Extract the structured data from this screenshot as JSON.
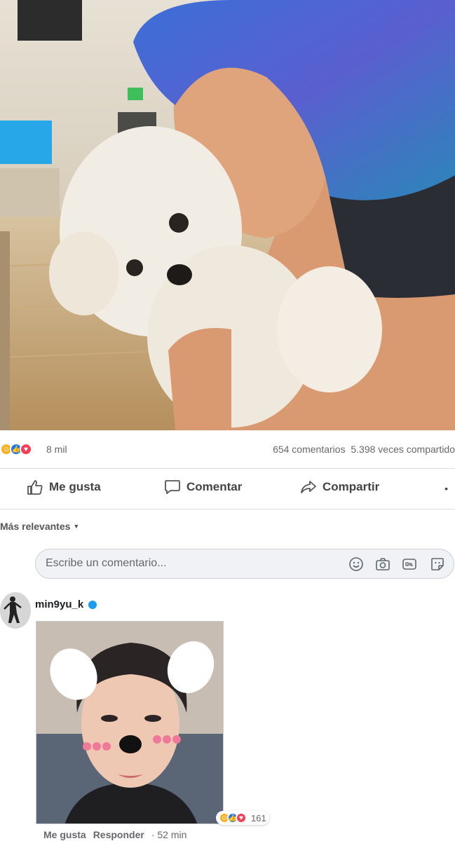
{
  "post": {
    "reaction_count": "8 mil",
    "comments_count": "654 comentarios",
    "shares_count": "5.398 veces compartido"
  },
  "actions": {
    "like": "Me gusta",
    "comment": "Comentar",
    "share": "Compartir",
    "more": "•"
  },
  "sort": {
    "label": "Más relevantes"
  },
  "comment_box": {
    "placeholder": "Escribe un comentario..."
  },
  "comment": {
    "username": "min9yu_k",
    "reaction_count": "161",
    "like_link": "Me gusta",
    "reply_link": "Responder",
    "time": "52 min"
  },
  "icons": {
    "like": "thumbs-up-icon",
    "comment": "speech-bubble-icon",
    "share": "share-arrow-icon",
    "emoji": "smiley-icon",
    "camera": "camera-icon",
    "gif": "gif-icon",
    "sticker": "sticker-icon"
  },
  "colors": {
    "like": "#1877f2",
    "love": "#f33e58",
    "haha": "#f7b125",
    "verified": "#1d9bf0"
  }
}
